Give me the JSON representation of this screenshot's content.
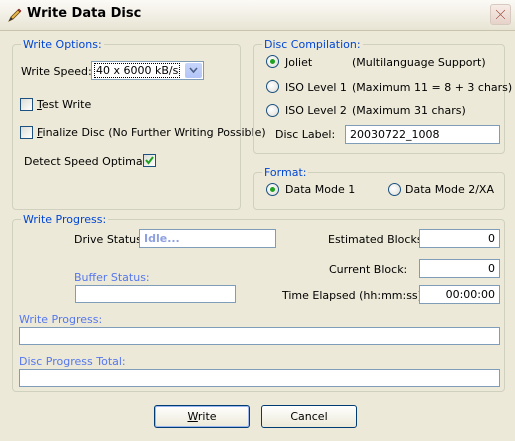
{
  "window": {
    "title": "Write Data Disc",
    "icon": "pencil-icon",
    "close_icon": "close-icon"
  },
  "write_options": {
    "legend": "Write Options:",
    "write_speed_label": "Write Speed:",
    "write_speed_value": "40 x  6000 kB/s",
    "test_write_label": "Test Write",
    "test_write_checked": false,
    "finalize_label": "Finalize Disc (No Further Writing Possible)",
    "finalize_checked": false,
    "detect_speed_label": "Detect Speed Optimals:",
    "detect_speed_checked": true
  },
  "disc_compilation": {
    "legend": "Disc Compilation:",
    "options": [
      {
        "label": "Joliet",
        "desc": "(Multilanguage Support)",
        "selected": true
      },
      {
        "label": "ISO Level 1",
        "desc": "(Maximum 11 =   8 + 3 chars)",
        "selected": false
      },
      {
        "label": "ISO Level 2",
        "desc": "(Maximum 31 chars)",
        "selected": false
      }
    ],
    "disc_label_label": "Disc Label:",
    "disc_label_value": "20030722_1008"
  },
  "format": {
    "legend": "Format:",
    "options": [
      {
        "label": "Data Mode 1",
        "selected": true
      },
      {
        "label": "Data Mode 2/XA",
        "selected": false
      }
    ]
  },
  "write_progress": {
    "legend": "Write Progress:",
    "drive_status_label": "Drive Status:",
    "drive_status_value": "Idle...",
    "estimated_blocks_label": "Estimated Blocks:",
    "estimated_blocks_value": "0",
    "buffer_status_label": "Buffer Status:",
    "current_block_label": "Current Block:",
    "current_block_value": "0",
    "time_elapsed_label": "Time Elapsed (hh:mm:ss):",
    "time_elapsed_value": "00:00:00",
    "write_progress_label": "Write Progress:",
    "disc_progress_label": "Disc Progress Total:"
  },
  "buttons": {
    "write": "Write",
    "cancel": "Cancel"
  }
}
